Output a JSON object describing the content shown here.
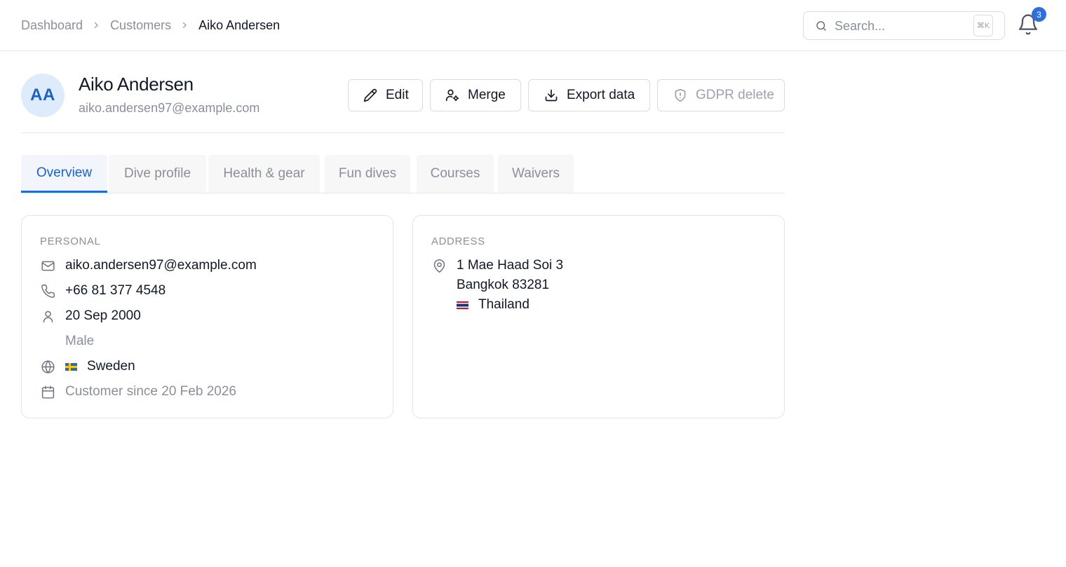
{
  "breadcrumb": {
    "items": [
      "Dashboard",
      "Customers",
      "Aiko Andersen"
    ]
  },
  "search": {
    "placeholder": "Search...",
    "shortcut": "⌘K"
  },
  "notifications": {
    "count": "3"
  },
  "customer": {
    "initials": "AA",
    "name": "Aiko Andersen",
    "email": "aiko.andersen97@example.com"
  },
  "actions": {
    "edit": "Edit",
    "merge": "Merge",
    "export": "Export data",
    "gdpr_delete": "GDPR delete"
  },
  "tabs": [
    {
      "label": "Overview",
      "active": true
    },
    {
      "label": "Dive profile",
      "active": false
    },
    {
      "label": "Health & gear",
      "active": false
    },
    {
      "label": "Fun dives",
      "active": false
    },
    {
      "label": "Courses",
      "active": false
    },
    {
      "label": "Waivers",
      "active": false
    }
  ],
  "personal": {
    "title": "PERSONAL",
    "email": "aiko.andersen97@example.com",
    "phone": "+66 81 377 4548",
    "birthdate": "20 Sep 2000",
    "gender": "Male",
    "nationality": "Sweden",
    "customer_since": "Customer since 20 Feb 2026"
  },
  "address": {
    "title": "ADDRESS",
    "line1": "1 Mae Haad Soi 3",
    "line2": "Bangkok 83281",
    "country": "Thailand"
  },
  "colors": {
    "accent": "#1d6fd6",
    "badge": "#2f6fdb",
    "avatar_bg": "#deebfb"
  }
}
